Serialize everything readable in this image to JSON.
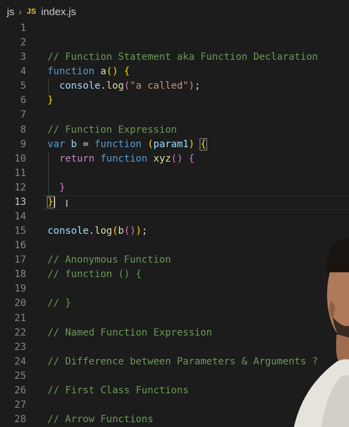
{
  "breadcrumb": {
    "folder": "js",
    "file_icon": "JS",
    "file": "index.js"
  },
  "editor": {
    "lines": [
      {
        "n": "1"
      },
      {
        "n": "2"
      },
      {
        "n": "3"
      },
      {
        "n": "4"
      },
      {
        "n": "5"
      },
      {
        "n": "6"
      },
      {
        "n": "7"
      },
      {
        "n": "8"
      },
      {
        "n": "9"
      },
      {
        "n": "10"
      },
      {
        "n": "11"
      },
      {
        "n": "12"
      },
      {
        "n": "13"
      },
      {
        "n": "14"
      },
      {
        "n": "15"
      },
      {
        "n": "16"
      },
      {
        "n": "17"
      },
      {
        "n": "18"
      },
      {
        "n": "19"
      },
      {
        "n": "20"
      },
      {
        "n": "21"
      },
      {
        "n": "22"
      },
      {
        "n": "23"
      },
      {
        "n": "24"
      },
      {
        "n": "25"
      },
      {
        "n": "26"
      },
      {
        "n": "27"
      },
      {
        "n": "28"
      }
    ],
    "code": {
      "l3": "// Function Statement aka Function Declaration",
      "l4_kw": "function",
      "l4_name": "a",
      "l4_paren": "()",
      "l4_brace": "{",
      "l5_obj": "console",
      "l5_dot": ".",
      "l5_fn": "log",
      "l5_open": "(",
      "l5_str": "\"a called\"",
      "l5_close": ")",
      "l5_semi": ";",
      "l6_brace": "}",
      "l8": "// Function Expression",
      "l9_var": "var",
      "l9_name": "b",
      "l9_eq": "=",
      "l9_kw": "function",
      "l9_open": "(",
      "l9_param": "param1",
      "l9_close": ")",
      "l9_brace": "{",
      "l10_ret": "return",
      "l10_kw": "function",
      "l10_name": "xyz",
      "l10_paren": "()",
      "l10_brace": "{",
      "l12_brace": "}",
      "l13_brace": "}",
      "l15_obj": "console",
      "l15_dot": ".",
      "l15_fn": "log",
      "l15_open": "(",
      "l15_b": "b",
      "l15_inner": "()",
      "l15_close": ")",
      "l15_semi": ";",
      "l17": "// Anonymous Function",
      "l18": "// function () {",
      "l20": "// }",
      "l22": "// Named Function Expression",
      "l24": "// Difference between Parameters & Arguments ?",
      "l26": "// First Class Functions",
      "l28": "// Arrow Functions"
    }
  },
  "colors": {
    "background": "#1c1c1c",
    "comment": "#6a9955",
    "keyword": "#569cd6",
    "control_keyword": "#c586c0",
    "function": "#dcdcaa",
    "variable": "#9cdcfe",
    "string": "#ce9178"
  }
}
